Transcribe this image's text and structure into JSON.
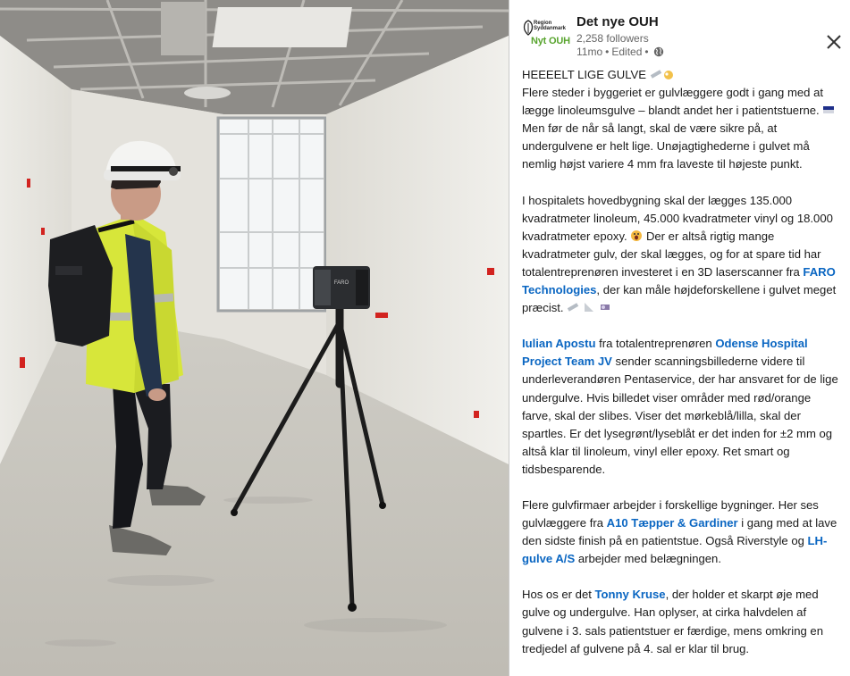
{
  "header": {
    "logo_top": "Region\nSyddanmark",
    "logo_bottom": "Nyt OUH",
    "org_name": "Det nye OUH",
    "followers": "2,258 followers",
    "age": "11mo",
    "edited": "Edited"
  },
  "icons": {
    "close": "close-icon",
    "visibility": "globe-icon",
    "logo_mark": "leaf-logo-icon"
  },
  "colors": {
    "link": "#0a66c2",
    "logo_green": "#58a42e"
  },
  "photo": {
    "scanner_label": "FARO"
  },
  "post": {
    "p1_l1": "HEEEELT LIGE GULVE",
    "p1_l2": "Flere steder i byggeriet er gulvlæggere godt i gang med at lægge linoleumsgulve – blandt andet her i patientstuerne.",
    "p1_l3": "Men før de når så langt, skal de være sikre på, at undergulvene er helt lige. Unøjagtighederne i gulvet må nemlig højst variere 4 mm fra laveste til højeste punkt.",
    "p2_a": "I hospitalets hovedbygning skal der lægges 135.000 kvadratmeter linoleum, 45.000 kvadratmeter vinyl og 18.000 kvadratmeter epoxy.",
    "p2_b": "Der er altså rigtig mange kvadratmeter gulv, der skal lægges, og for at spare tid har totalentreprenøren investeret i en 3D laserscanner fra",
    "p2_link": "FARO Technologies",
    "p2_c": ", der kan måle højdeforskellene i gulvet meget præcist.",
    "p3_link1": "Iulian Apostu",
    "p3_a": " fra totalentreprenøren ",
    "p3_link2": "Odense Hospital Project Team JV",
    "p3_b": " sender scanningsbillederne videre til underleverandøren Pentaservice, der har ansvaret for de lige undergulve. Hvis billedet viser områder med rød/orange farve, skal der slibes. Viser det mørkeblå/lilla, skal der spartles. Er det lysegrønt/lyseblåt er det inden for ±2 mm og altså klar til linoleum, vinyl eller epoxy. Ret smart og tidsbesparende.",
    "p4_a": "Flere gulvfirmaer arbejder i forskellige bygninger. Her ses gulvlæggere fra ",
    "p4_link1": "A10 Tæpper & Gardiner",
    "p4_b": " i gang med at lave den sidste finish på en patientstue. Også Riverstyle og ",
    "p4_link2": "LH-gulve A/S",
    "p4_c": " arbejder med belægningen.",
    "p5_a": "Hos os er det ",
    "p5_link": "Tonny Kruse",
    "p5_b": ", der holder et skarpt øje med gulve og undergulve. Han oplyser, at cirka halvdelen af gulvene i 3. sals patientstuer er færdige, mens omkring en tredjedel af gulvene på 4. sal er klar til brug."
  }
}
